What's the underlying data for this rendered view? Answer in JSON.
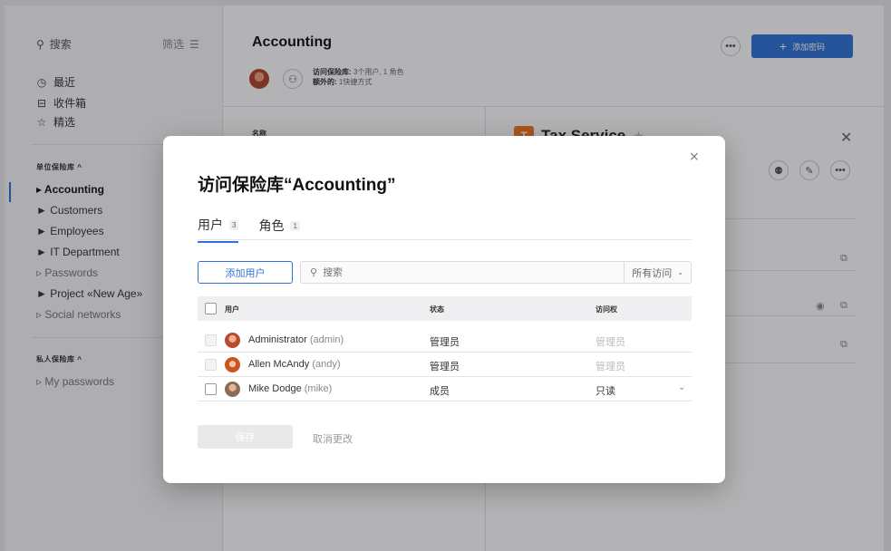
{
  "sidebar": {
    "search_label": "搜索",
    "filter_label": "筛选",
    "nav": [
      {
        "icon": "clock-icon",
        "glyph": "◷",
        "label": "最近"
      },
      {
        "icon": "inbox-icon",
        "glyph": "⊟",
        "label": "收件箱"
      },
      {
        "icon": "star-icon",
        "glyph": "☆",
        "label": "精选"
      }
    ],
    "shared_title": "单位保险库 ^",
    "shared_vaults": [
      "Accounting",
      "Customers",
      "Employees",
      "IT Department",
      "Passwords",
      "Project «New Age»",
      "Social networks"
    ],
    "private_title": "私人保险库 ^",
    "private_vaults": [
      "My passwords"
    ]
  },
  "header": {
    "title": "Accounting",
    "meta_access_label": "访问保险库:",
    "meta_access_value": "3个用户, 1 角色",
    "meta_extra_label": "额外的:",
    "meta_extra_value": "1快捷方式",
    "add_password_label": "添加密码"
  },
  "list": {
    "column_name": "名称"
  },
  "detail": {
    "letter": "T",
    "title": "Tax Service",
    "accent": "#f2761c"
  },
  "modal": {
    "title": "访问保险库“Accounting”",
    "tabs": [
      {
        "label": "用户",
        "count": "3"
      },
      {
        "label": "角色",
        "count": "1"
      }
    ],
    "add_user_label": "添加用户",
    "search_placeholder": "搜索",
    "access_filter": "所有访问",
    "columns": {
      "user": "用户",
      "status": "状态",
      "access": "访问权"
    },
    "rows": [
      {
        "name": "Administrator",
        "login": "(admin)",
        "status": "管理员",
        "access": "管理员",
        "editable": false
      },
      {
        "name": "Allen McAndy",
        "login": "(andy)",
        "status": "管理员",
        "access": "管理员",
        "editable": false
      },
      {
        "name": "Mike Dodge",
        "login": "(mike)",
        "status": "成员",
        "access": "只读",
        "editable": true
      }
    ],
    "save_label": "保存",
    "cancel_label": "取消更改"
  },
  "colors": {
    "accent": "#2f73d8"
  }
}
